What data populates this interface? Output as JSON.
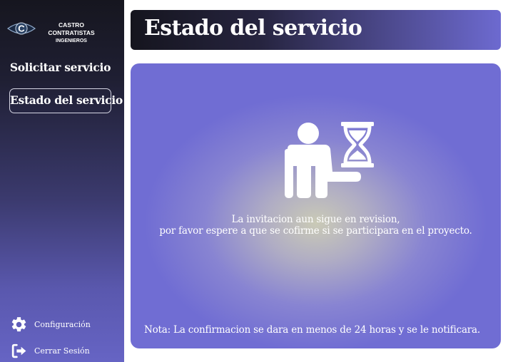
{
  "brand": {
    "name_line1": "CASTRO CONTRATISTAS",
    "name_line2": "INGENIEROS",
    "logo_letter": "C",
    "logo_icon": "eye-logo-icon"
  },
  "sidebar": {
    "items": [
      {
        "label": "Solicitar servicio",
        "active": false
      },
      {
        "label": "Estado del servicio",
        "active": true
      }
    ],
    "bottom": [
      {
        "label": "Configuración",
        "icon": "gear-icon"
      },
      {
        "label": "Cerrar Sesión",
        "icon": "logout-icon"
      }
    ]
  },
  "header": {
    "title": "Estado del servicio"
  },
  "status": {
    "icon": "person-hourglass-icon",
    "message_line1": "La invitacion aun sigue en revision,",
    "message_line2": "por favor espere a que se cofirme si se participara en el proyecto.",
    "note": "Nota: La confirmacion se dara en menos de 24 horas y se le notificara."
  },
  "colors": {
    "accent": "#6e6bd3",
    "sidebar_dark": "#16161f",
    "text": "#ffffff"
  }
}
